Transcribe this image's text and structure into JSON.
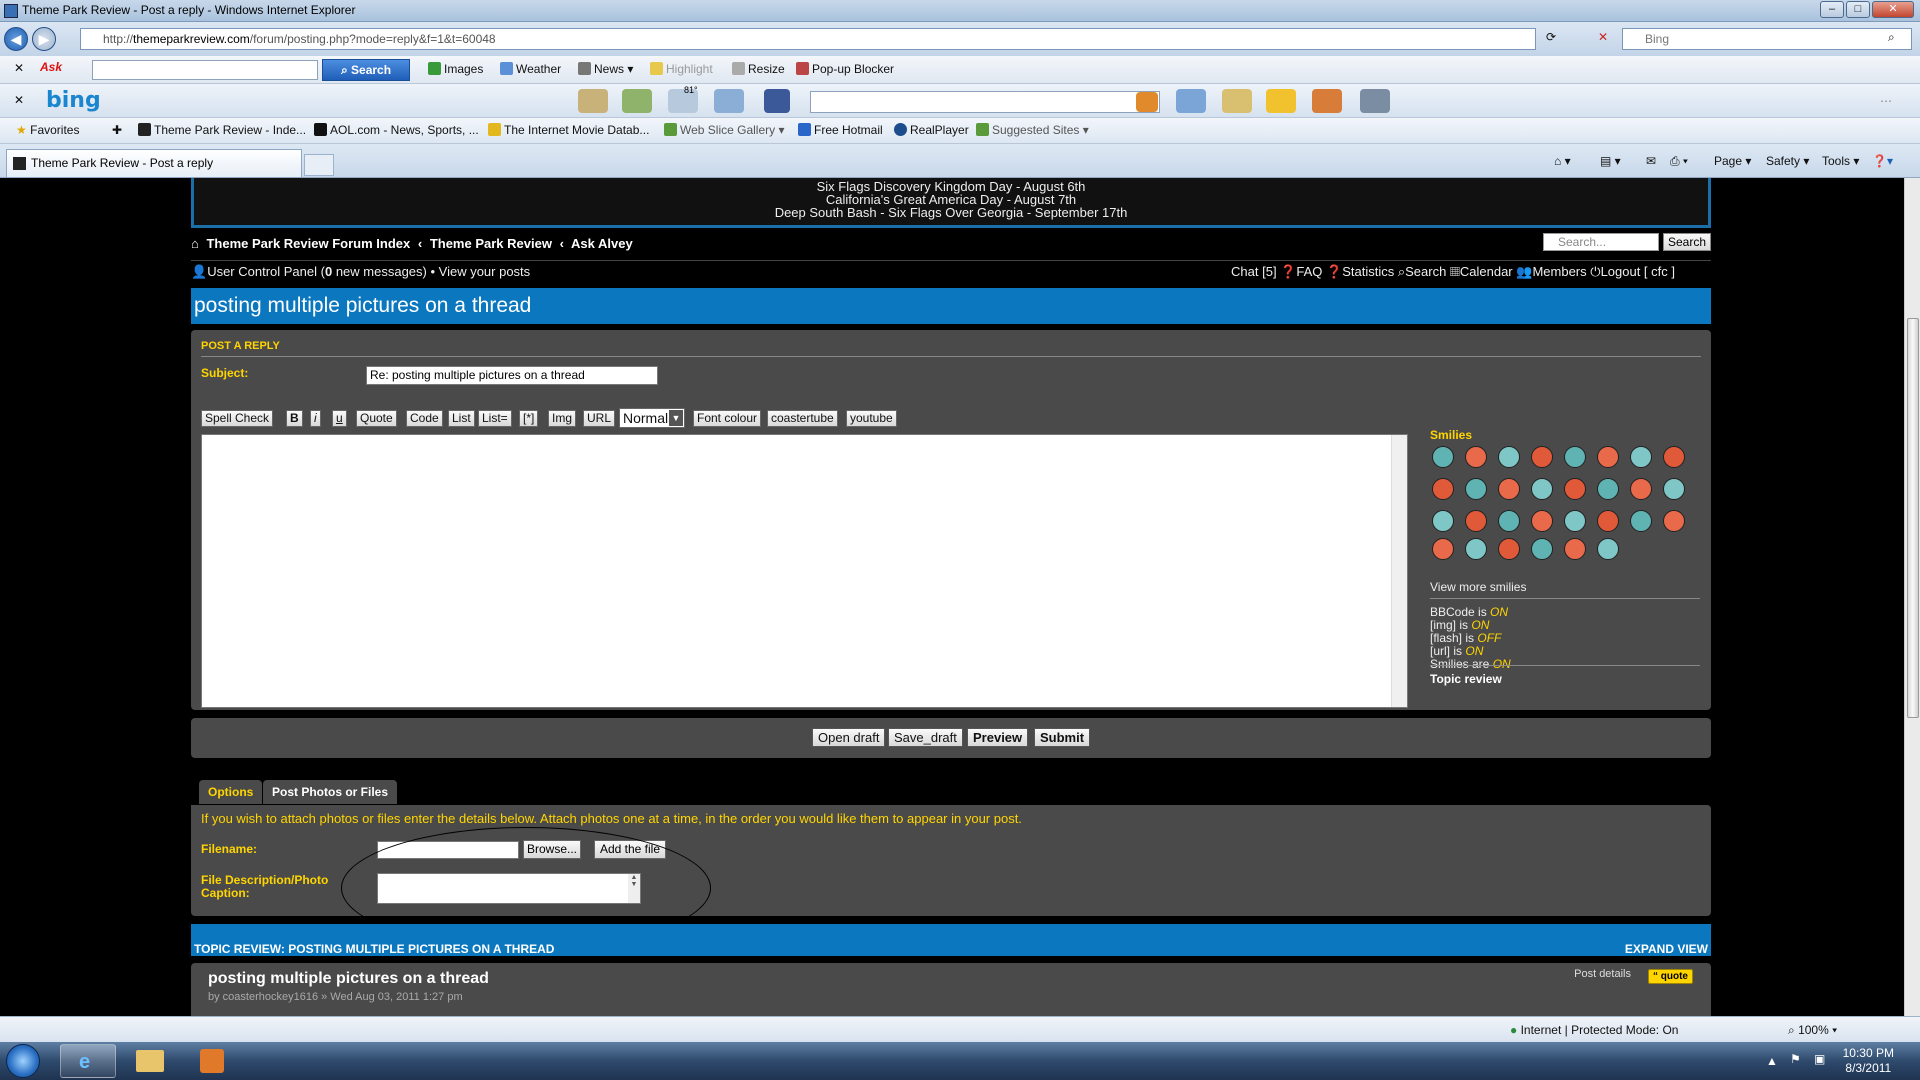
{
  "window": {
    "title": "Theme Park Review - Post a reply - Windows Internet Explorer",
    "minimize": "–",
    "maximize": "□",
    "close": "✕"
  },
  "address": {
    "url_prefix": "http://",
    "url_host": "themeparkreview.com",
    "url_path": "/forum/posting.php?mode=reply&f=1&t=60048",
    "search_engine": "Bing"
  },
  "ask_toolbar": {
    "logo": "Ask",
    "search_label": "Search",
    "items": [
      "Images",
      "Weather",
      "News",
      "Highlight",
      "Resize",
      "Pop-up Blocker"
    ]
  },
  "bing_toolbar": {
    "logo": "bing",
    "weather_temp": "81°"
  },
  "favorites_bar": {
    "favorites_label": "Favorites",
    "items": [
      "Theme Park Review - Inde...",
      "AOL.com - News, Sports, ...",
      "The Internet Movie Datab...",
      "Web Slice Gallery",
      "Free Hotmail",
      "RealPlayer",
      "Suggested Sites"
    ]
  },
  "tabs": {
    "active": "Theme Park Review - Post a reply"
  },
  "command_bar": {
    "page": "Page",
    "safety": "Safety",
    "tools": "Tools"
  },
  "banner": {
    "lines": [
      "Six Flags Discovery Kingdom Day - August 6th",
      "California's Great America Day - August 7th",
      "Deep South Bash - Six Flags Over Georgia - September 17th"
    ]
  },
  "breadcrumb": {
    "items": [
      "Theme Park Review Forum Index",
      "Theme Park Review",
      "Ask Alvey"
    ],
    "separator": "‹"
  },
  "site_search": {
    "placeholder": "Search...",
    "button": "Search"
  },
  "user_bar": {
    "ucp": "User Control Panel (",
    "new_count": "0",
    "new_suffix": " new messages)",
    "sep": " • ",
    "view_posts": "View your posts",
    "chat": "Chat [5]",
    "faq": "FAQ",
    "statistics": "Statistics",
    "search": "Search",
    "calendar": "Calendar",
    "members": "Members",
    "logout": "Logout [ cfc ]"
  },
  "topic": {
    "title": "posting multiple pictures on a thread"
  },
  "post_form": {
    "section_label": "POST A REPLY",
    "subject_label": "Subject:",
    "subject_value": "Re: posting multiple pictures on a thread",
    "format_buttons": [
      "Spell Check",
      "B",
      "i",
      "u",
      "Quote",
      "Code",
      "List",
      "List=",
      "[*]",
      "Img",
      "URL"
    ],
    "font_size": "Normal",
    "extra_buttons": [
      "Font colour",
      "coastertube",
      "youtube"
    ],
    "message_value": ""
  },
  "sidebar": {
    "smilies_title": "Smilies",
    "view_more": "View more smilies",
    "bbcode": [
      {
        "label": "BBCode",
        "is": " is ",
        "state": "ON"
      },
      {
        "label": "[img]",
        "is": " is ",
        "state": "ON"
      },
      {
        "label": "[flash]",
        "is": " is ",
        "state": "OFF"
      },
      {
        "label": "[url]",
        "is": " is ",
        "state": "ON"
      },
      {
        "label": "Smilies",
        "is": " are ",
        "state": "ON"
      }
    ],
    "topic_review": "Topic review"
  },
  "actions": {
    "open_draft": "Open draft",
    "save_draft": "Save_draft",
    "preview": "Preview",
    "submit": "Submit"
  },
  "attach_tabs": {
    "options": "Options",
    "post_photos": "Post Photos or Files"
  },
  "attach": {
    "message": "If you wish to attach photos or files enter the details below. Attach photos one at a time, in the order you would like them to appear in your post.",
    "filename_label": "Filename:",
    "browse": "Browse...",
    "add_file": "Add the file",
    "caption_label_1": "File Description/Photo",
    "caption_label_2": "Caption:"
  },
  "topic_review": {
    "header": "TOPIC REVIEW: POSTING MULTIPLE PICTURES ON A THREAD",
    "expand": "EXPAND VIEW",
    "post_title": "posting multiple pictures on a thread",
    "post_by": "by coasterhockey1616 » Wed Aug 03, 2011 1:27 pm",
    "post_details": "Post details",
    "quote": "quote"
  },
  "statusbar": {
    "zone": "Internet | Protected Mode: On",
    "zoom": "100%"
  },
  "taskbar": {
    "time": "10:30 PM",
    "date": "8/3/2011"
  },
  "colors": {
    "heading": "#0b77bf",
    "label": "#ffd500",
    "panel": "#4a4a4a"
  }
}
